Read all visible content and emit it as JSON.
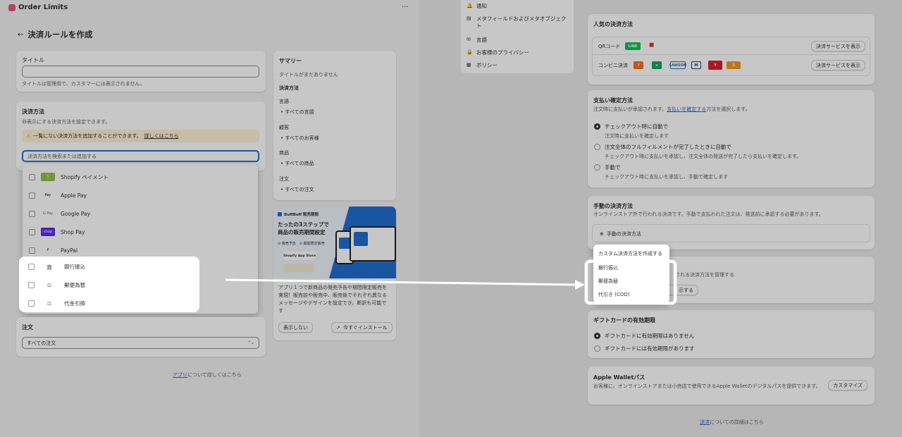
{
  "app": {
    "name": "Order Limits",
    "menu": "···"
  },
  "page": {
    "back": "←",
    "title": "決済ルールを作成"
  },
  "title_card": {
    "label": "タイトル",
    "help": "タイトルは管理用で、カスタマーには表示されません。"
  },
  "payment_card": {
    "title": "決済方法",
    "desc": "非表示にする決済方法を設定できます。",
    "banner_text": "一覧にない決済方法を追加することができます。",
    "banner_link": "詳しくはこちら",
    "search_placeholder": "決済方法を検索または追加する"
  },
  "payment_options": [
    {
      "label": "Shopify ペイメント",
      "icon": "shopify-icon"
    },
    {
      "label": "Apple Pay",
      "icon": "apple-pay-icon"
    },
    {
      "label": "Google Pay",
      "icon": "google-pay-icon"
    },
    {
      "label": "Shop Pay",
      "icon": "shop-pay-icon"
    },
    {
      "label": "PayPal",
      "icon": "paypal-icon"
    }
  ],
  "highlight_options": [
    {
      "label": "銀行振込",
      "icon": "bank-icon"
    },
    {
      "label": "郵便為替",
      "icon": "postal-icon"
    },
    {
      "label": "代金引換",
      "icon": "cod-icon"
    }
  ],
  "order_card": {
    "title": "注文",
    "select_value": "すべての注文",
    "chevron": "⌃⌄"
  },
  "footer": {
    "link": "アプリ",
    "text": "について詳しくはこちら"
  },
  "summary": {
    "title": "サマリー",
    "no_title": "タイトルがまだありません",
    "payment_label": "決済方法",
    "language_label": "言語",
    "language_value": "すべての言語",
    "customer_label": "顧客",
    "customer_value": "すべてのお客様",
    "product_label": "商品",
    "product_value": "すべての商品",
    "order_label": "注文",
    "order_value": "すべての注文"
  },
  "promo": {
    "brand": "BuffBuff 販売期間",
    "headline1": "たったの3ステップで",
    "headline2": "商品の販売期間設定",
    "tag1": "販売予告",
    "tag2": "期間限定販売",
    "store_badge": "Shopify App Store",
    "desc": "アプリ１つで新商品の発売予告や期間限定販売を実現！販売前や販売中、販売後でそれぞれ異なるメッセージやデザインを設定でき、断訳も可能です",
    "hide_btn": "表示しない",
    "install_btn": "今すぐインストール"
  },
  "settings_nav": [
    {
      "label": "通知",
      "icon": "bell-icon"
    },
    {
      "label": "メタフィールドおよびメタオブジェクト",
      "icon": "database-icon"
    },
    {
      "label": "言語",
      "icon": "language-icon"
    },
    {
      "label": "お客様のプライバシー",
      "icon": "lock-icon"
    },
    {
      "label": "ポリシー",
      "icon": "policy-icon"
    }
  ],
  "popular": {
    "title": "人気の決済方法",
    "qr_label": "QRコード",
    "konbini_label": "コンビニ決済",
    "view_btn": "決済サービスを表示"
  },
  "capture": {
    "title": "支払い確定方法",
    "desc_pre": "注文時に支払いが承認されます。",
    "desc_link": "支払いを確定する",
    "desc_post": "方法を選択します。",
    "options": [
      {
        "label": "チェックアウト時に自動で",
        "desc": "注文時に支払いを確定します"
      },
      {
        "label": "注文全体のフルフィルメントが完了したときに自動で",
        "desc": "チェックアウト時に支払いを承認し、注文全体の発送が完了したら支払いを確定します。"
      },
      {
        "label": "手動で",
        "desc": "チェックアウト時に支払いを承認し、手動で確定します"
      }
    ]
  },
  "manual": {
    "title": "手動の決済方法",
    "desc": "オンラインストア外で行われる決済です。手動で支払われた注文は、発送前に承認する必要があります。",
    "add_btn": "手動の決済方法",
    "menu": [
      "カスタム決済方法を作成する",
      "銀行振込",
      "郵便為替",
      "代引き (COD)"
    ]
  },
  "hidden_card": {
    "partial": "される決済方法を管理する",
    "btn": "示する"
  },
  "giftcard": {
    "title": "ギフトカードの有効期限",
    "opt1": "ギフトカードに有効期限はありません",
    "opt2": "ギフトカードには有効期限があります"
  },
  "wallet": {
    "title": "Apple Walletパス",
    "desc": "お客様に、オンラインストアまたは小売店で使用できるApple Walletのデジタルパスを提供できます。",
    "btn": "カスタマイズ"
  },
  "right_footer": {
    "link": "決済",
    "text": "についての詳細はこちら"
  },
  "colors": {
    "accent": "#2c6ecb",
    "warning_bg": "#fff1d6",
    "shop_purple": "#5a31f4"
  }
}
